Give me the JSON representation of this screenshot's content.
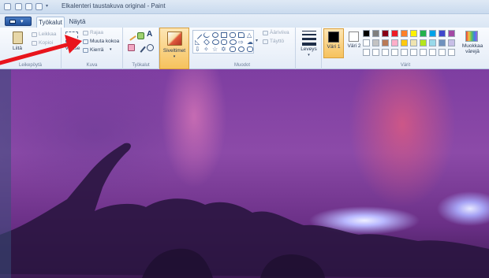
{
  "window": {
    "title": "Elkalenteri taustakuva original - Paint"
  },
  "tabs": [
    {
      "label": "Työkalut"
    },
    {
      "label": "Näytä"
    }
  ],
  "clipboard": {
    "paste": "Liitä",
    "cut": "Leikkaa",
    "copy": "Kopioi",
    "group": "Leikepöytä"
  },
  "image": {
    "select": "Valitse",
    "crop": "Rajaa",
    "resize": "Muuta kokoa",
    "rotate": "Kierrä",
    "group": "Kuva"
  },
  "tools": {
    "group": "Työkalut"
  },
  "brushes": {
    "label": "Siveltimet"
  },
  "shapes": {
    "outline": "Ääriviiva",
    "fill": "Täyttö",
    "group": "Muodot"
  },
  "size": {
    "label": "Leveys"
  },
  "colors": {
    "color1": "Väri 1",
    "color2": "Väri 2",
    "edit": "Muokkaa värejä",
    "group": "Värit",
    "color1_value": "#000000",
    "color2_value": "#ffffff",
    "palette_row1": [
      "#000000",
      "#7f7f7f",
      "#880015",
      "#ed1c24",
      "#ff7f27",
      "#fff200",
      "#22b14c",
      "#00a2e8",
      "#3f48cc",
      "#a349a4"
    ],
    "palette_row2": [
      "#ffffff",
      "#c3c3c3",
      "#b97a57",
      "#ffaec9",
      "#ffc90e",
      "#efe4b0",
      "#b5e61d",
      "#99d9ea",
      "#7092be",
      "#c8bfe7"
    ]
  },
  "annotation": {
    "arrow_color": "#e8141c"
  }
}
